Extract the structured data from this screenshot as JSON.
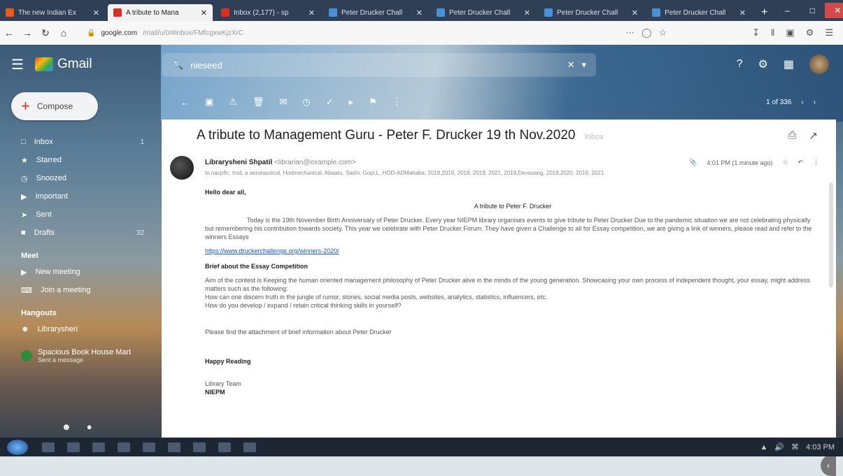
{
  "browser": {
    "tabs": [
      {
        "label": "The new Indian Ex",
        "active": false,
        "color": "#e8581f"
      },
      {
        "label": "A tribute to Mana",
        "active": true,
        "color": "#d93025"
      },
      {
        "label": "Inbox (2,177) - sp",
        "active": false,
        "color": "#d93025"
      },
      {
        "label": "Peter Drucker Chall",
        "active": false,
        "color": "#4a90d9"
      },
      {
        "label": "Peter Drucker Chall",
        "active": false,
        "color": "#4a90d9"
      },
      {
        "label": "Peter Drucker Chall",
        "active": false,
        "color": "#4a90d9"
      },
      {
        "label": "Peter Drucker Chall",
        "active": false,
        "color": "#4a90d9"
      }
    ],
    "url_host": "google.com",
    "url_rest": "/mail/u/0/#inbox/FMfcgxwKjzXrC"
  },
  "gmail": {
    "app_name": "Gmail",
    "search_value": "nieseed",
    "compose_label": "Compose",
    "nav": [
      {
        "icon": "inbox-icon",
        "label": "Inbox",
        "count": "1"
      },
      {
        "icon": "star-icon",
        "label": "Starred",
        "count": ""
      },
      {
        "icon": "clock-icon",
        "label": "Snoozed",
        "count": ""
      },
      {
        "icon": "important-icon",
        "label": "Important",
        "count": ""
      },
      {
        "icon": "send-icon",
        "label": "Sent",
        "count": ""
      },
      {
        "icon": "draft-icon",
        "label": "Drafts",
        "count": "32"
      }
    ],
    "meet_title": "Meet",
    "meet_items": [
      {
        "icon": "video-icon",
        "label": "New meeting"
      },
      {
        "icon": "keyboard-icon",
        "label": "Join a meeting"
      }
    ],
    "hangouts_title": "Hangouts",
    "hangouts_user": "Librarysheri",
    "hangout_contact": "Spacious Book House Mart",
    "hangout_status": "Sent a message",
    "pager": "1 of 336"
  },
  "email": {
    "subject": "A tribute to Management Guru - Peter F. Drucker 19 th Nov.2020",
    "subject_tag": "Inbox",
    "sender_name": "Librarysheni Shpatil",
    "sender_email": "<librarian@example.com>",
    "recipients": "to nacpftc, hod, a aeronautical, Hodmechanical, Abaaru, Sashi, Gopi.L, HOD-ADMahaba, 2018,2019, 2018, 2019, 2021, 2018,Devasang, 2019,2020, 2019, 2021",
    "time": "4:01 PM (1 minute ago)",
    "greeting": "Hello dear all,",
    "title_line": "A tribute to Peter F. Drucker",
    "para1": "Today is the 19th November Birth Anniversary of Peter Drucker. Every year NIEPM library organises events to give tribute to Peter Drucker Due to the pandemic situation we are not celebrating physically but remembering his contribution towards society. This year we celebrate with Peter Drucker Forum. They have given a Challenge to all for Essay competition, we are giving a link of winners, please read and refer to the winners Essays",
    "link": "https://www.druckerchallenge.org/winners-2020/",
    "brief_title": "Brief about the Essay Competition",
    "para2": "Aim of the contest is Keeping the human oriented management philosophy of Peter Drucker alive in the minds of the young generation. Showcasing your own process of independent thought, your essay, might address matters such as the following:",
    "q1": "How can one discern truth in the jungle of rumor, stories, social media posts, websites, analytics, statistics, influencers, etc.",
    "q2": "How do you develop / expand / retain critical thinking skills in yourself?",
    "para3": "Please find the attachment of brief information about Peter Drucker",
    "signoff": "Happy Reading",
    "team": "Library Team",
    "org": "NIEPM"
  },
  "taskbar": {
    "time": "4:03 PM"
  }
}
